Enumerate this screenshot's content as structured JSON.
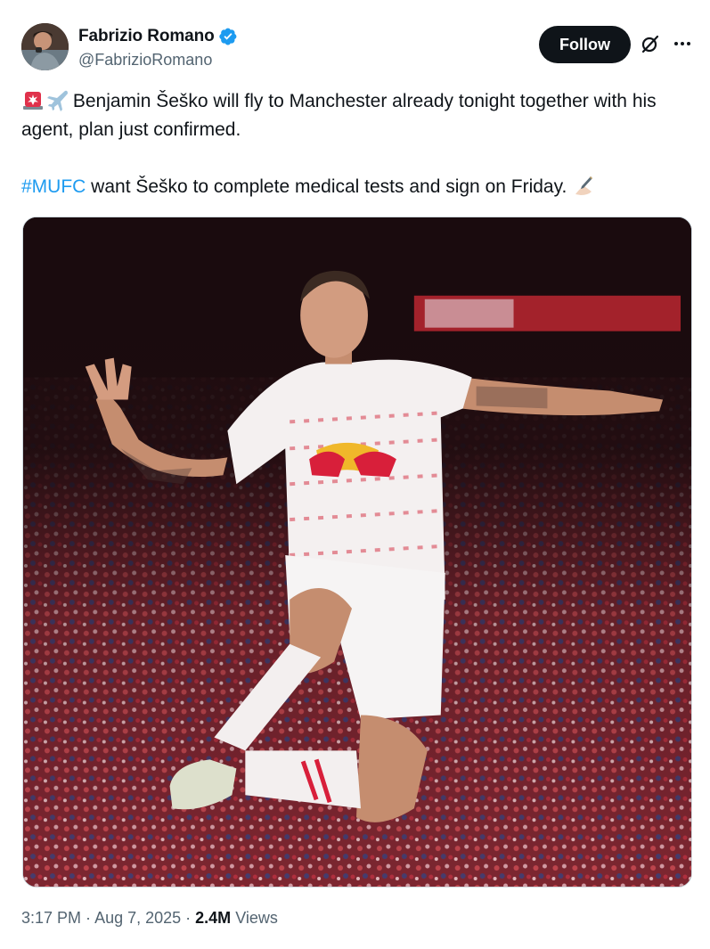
{
  "author": {
    "display_name": "Fabrizio Romano",
    "handle": "@FabrizioRomano",
    "verified": true,
    "verified_color": "#1d9bf0"
  },
  "actions": {
    "follow_label": "Follow",
    "grok_icon": "grok-icon",
    "more_icon": "more-icon"
  },
  "tweet": {
    "line1_text": " Benjamin Šeško will fly to Manchester already tonight together with his agent, plan just confirmed.",
    "line1_emojis": [
      "rotating-light",
      "airplane"
    ],
    "hashtag": "#MUFC",
    "line2_text": " want Šeško to complete medical tests and sign on Friday. ",
    "line2_emoji": "writing-hand",
    "image_subject": "Benjamin Šeško jumping in white RB Leipzig kit in front of a crowd"
  },
  "meta": {
    "time": "3:17 PM",
    "separator": " · ",
    "date": "Aug 7, 2025",
    "separator2": " · ",
    "views_count": "2.4M",
    "views_label": " Views"
  },
  "colors": {
    "text": "#0f1419",
    "secondary": "#536471",
    "link": "#1d9bf0",
    "follow_bg": "#0f1419"
  }
}
